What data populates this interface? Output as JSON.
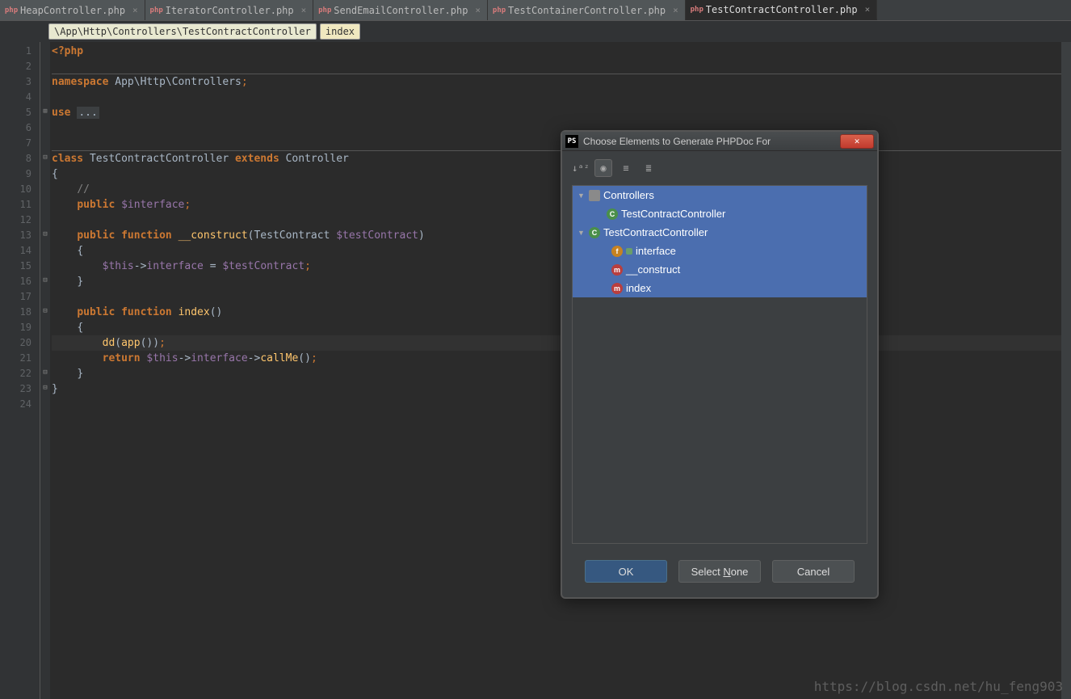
{
  "tabs": [
    {
      "label": "HeapController.php"
    },
    {
      "label": "IteratorController.php"
    },
    {
      "label": "SendEmailController.php"
    },
    {
      "label": "TestContainerController.php"
    },
    {
      "label": "TestContractController.php",
      "active": true
    }
  ],
  "breadcrumb": {
    "path": "\\App\\Http\\Controllers\\TestContractController",
    "method": "index"
  },
  "code": {
    "l1": "<?php",
    "l3_ns": "namespace",
    "l3_path": " App\\Http\\Controllers",
    "l5_use": "use",
    "l5_dots": "...",
    "l8_class": "class",
    "l8_name": " TestContractController ",
    "l8_ext": "extends",
    "l8_parent": " Controller",
    "l10_comment": "//",
    "l11_pub": "public",
    "l11_var": " $interface",
    "l13_pub": "public",
    "l13_func": "function",
    "l13_name": "__construct",
    "l13_param_type": "TestContract ",
    "l13_param_var": "$testContract",
    "l15_this": "$this",
    "l15_prop": "interface",
    "l15_assign": " = ",
    "l15_val": "$testContract",
    "l18_pub": "public",
    "l18_func": "function",
    "l18_name": "index",
    "l20_dd": "dd",
    "l20_app": "app",
    "l21_ret": "return",
    "l21_this": " $this",
    "l21_prop": "interface",
    "l21_call": "callMe"
  },
  "dialog": {
    "title": "Choose Elements to Generate PHPDoc For",
    "icon": "PS",
    "tree": {
      "controllers": "Controllers",
      "class1": "TestContractController",
      "class2": "TestContractController",
      "field": "interface",
      "method1": "__construct",
      "method2": "index"
    },
    "buttons": {
      "ok": "OK",
      "select_none_pre": "Select ",
      "select_none_u": "N",
      "select_none_post": "one",
      "cancel": "Cancel"
    }
  },
  "watermark": "https://blog.csdn.net/hu_feng903",
  "line_numbers": [
    "1",
    "2",
    "3",
    "4",
    "5",
    "6",
    "7",
    "8",
    "9",
    "10",
    "11",
    "12",
    "13",
    "14",
    "15",
    "16",
    "17",
    "18",
    "19",
    "20",
    "21",
    "22",
    "23",
    "24"
  ]
}
